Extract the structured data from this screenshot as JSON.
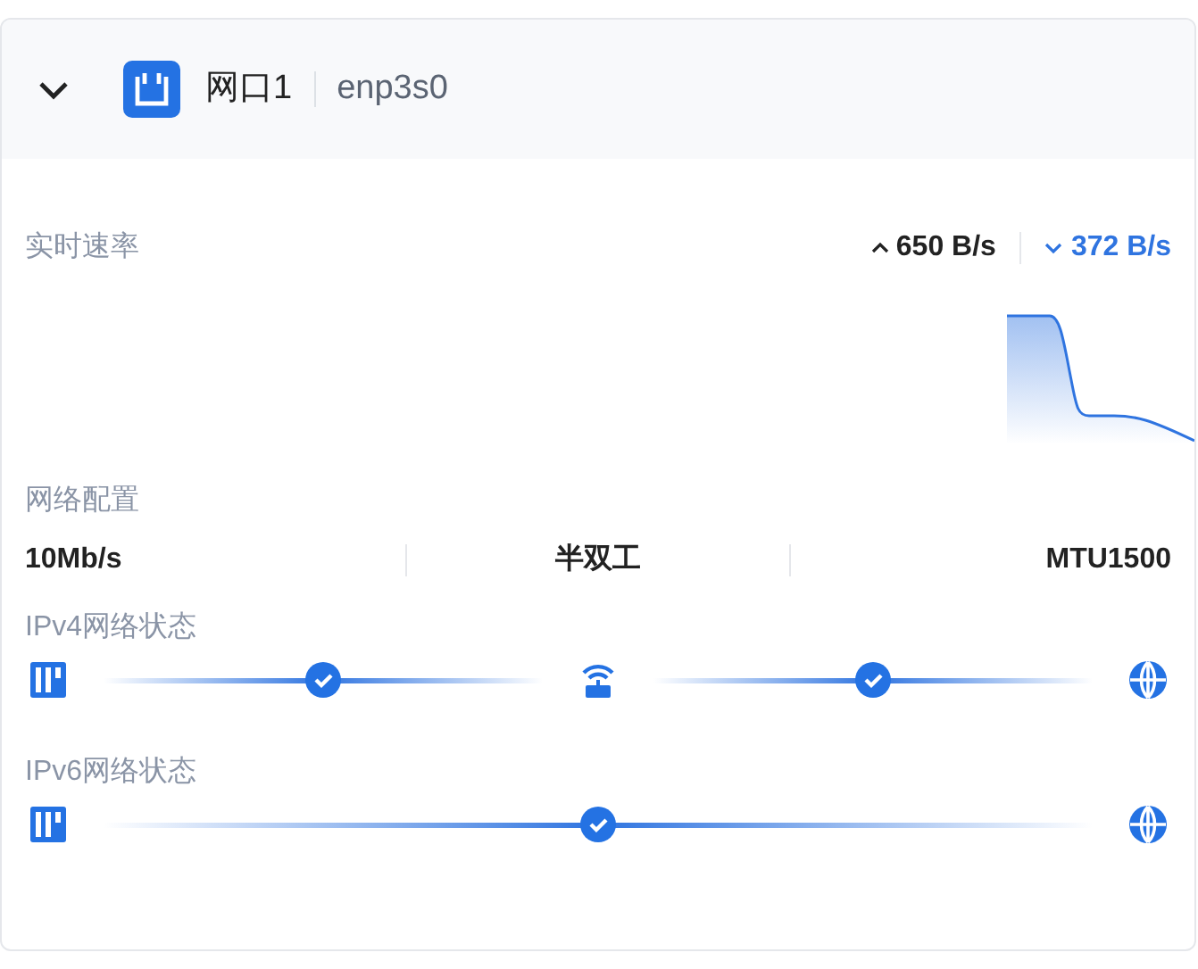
{
  "port": {
    "title": "网口1",
    "device": "enp3s0",
    "expanded": true
  },
  "rate": {
    "label": "实时速率",
    "upload": "650 B/s",
    "download": "372 B/s"
  },
  "config": {
    "label": "网络配置",
    "values": [
      "10Mb/s",
      "半双工",
      "MTU1500"
    ]
  },
  "status": [
    {
      "label": "IPv4网络状态",
      "nodes": [
        {
          "kind": "server"
        },
        {
          "kind": "router"
        },
        {
          "kind": "globe"
        }
      ],
      "links": [
        {
          "connected": true
        },
        {
          "connected": true
        }
      ]
    },
    {
      "label": "IPv6网络状态",
      "nodes": [
        {
          "kind": "server"
        },
        {
          "kind": "globe"
        }
      ],
      "links": [
        {
          "connected": true
        }
      ]
    }
  ]
}
